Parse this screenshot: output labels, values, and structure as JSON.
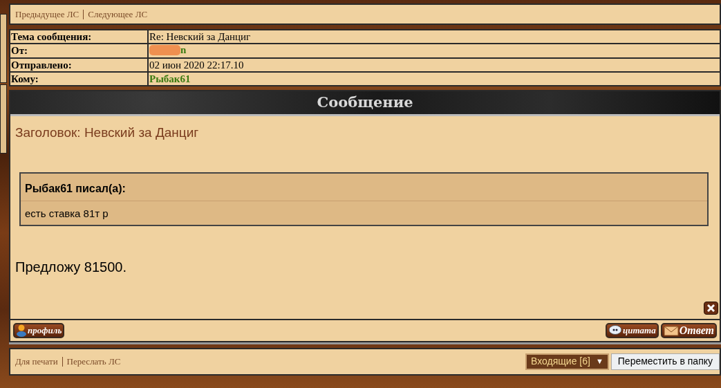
{
  "nav_links": [
    "Предыдущее ЛС",
    "Следующее ЛС"
  ],
  "header_table": [
    {
      "label": "Тема сообщения:",
      "value": "Re: Невский за Данциг",
      "kind": "plain",
      "redacted": false
    },
    {
      "label": "От:",
      "value": "n",
      "kind": "user",
      "redacted": true
    },
    {
      "label": "Отправлено:",
      "value": "02 июн 2020 22:17.10",
      "kind": "plain",
      "redacted": false
    },
    {
      "label": "Кому:",
      "value": "Рыбак61",
      "kind": "user",
      "redacted": false
    }
  ],
  "section_title": "Сообщение",
  "message": {
    "subject": "Заголовок: Невский за Данциг",
    "quote": {
      "author": "Рыбак61 писал(а):",
      "text": "есть ставка 81т р"
    },
    "body": "Предложу 81500."
  },
  "buttons": {
    "left": [
      {
        "label": "профиль",
        "kind": "profile"
      }
    ],
    "right": [
      {
        "label": "цитата",
        "kind": "quote"
      },
      {
        "label": "Ответ",
        "kind": "reply"
      }
    ]
  },
  "footer_links": [
    "Для печати",
    "Переслать ЛС"
  ],
  "folder_select": {
    "value": "Входящие [6]",
    "arrow": "▼"
  },
  "move_button": "Переместить в папку"
}
